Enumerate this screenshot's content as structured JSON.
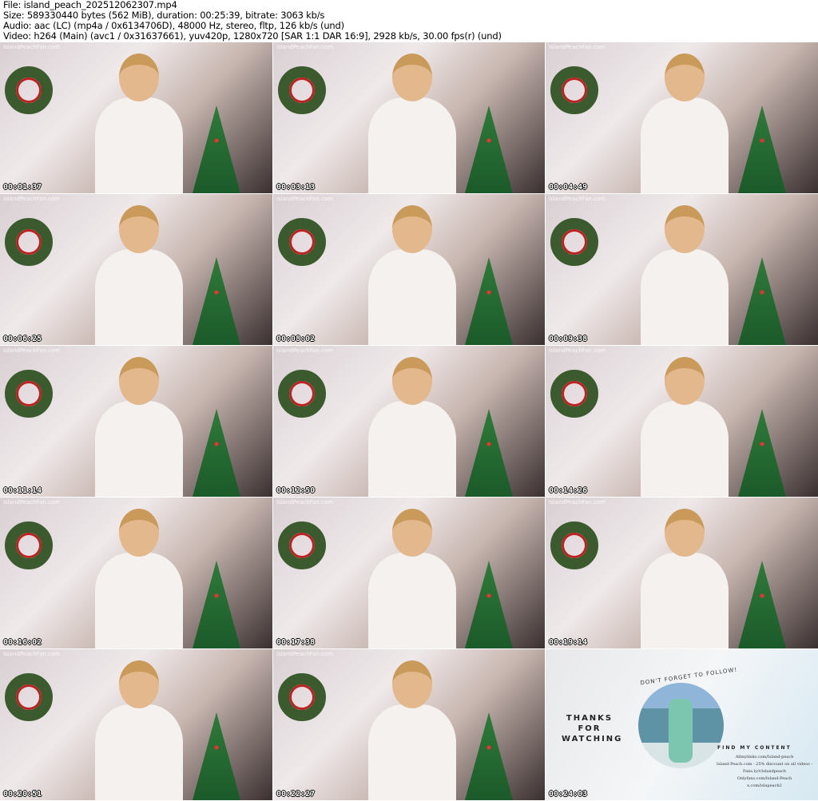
{
  "header": {
    "file": "File: island_peach_202512062307.mp4",
    "size": "Size: 589330440 bytes (562 MiB), duration: 00:25:39, bitrate: 3063 kb/s",
    "audio": "Audio: aac (LC) (mp4a / 0x6134706D), 48000 Hz, stereo, fltp, 126 kb/s (und)",
    "video": "Video: h264 (Main) (avc1 / 0x31637661), yuv420p, 1280x720 [SAR 1:1 DAR 16:9], 2928 kb/s, 30.00 fps(r) (und)"
  },
  "watermark": "IslandPeachFan.com",
  "thumbnails": [
    "00:01:37",
    "00:03:13",
    "00:04:49",
    "00:06:25",
    "00:08:02",
    "00:09:38",
    "00:11:14",
    "00:12:50",
    "00:14:26",
    "00:16:02",
    "00:17:38",
    "00:19:14",
    "00:20:51",
    "00:22:27"
  ],
  "end_card": {
    "timestamp": "00:24:03",
    "thanks": "THANKS FOR WATCHING",
    "follow": "DON'T FORGET TO FOLLOW!",
    "find": "FIND MY CONTENT",
    "links": [
      "Allmylinks.com/Island-peach",
      "Island-Peach.com - 25% discount on all videos -",
      "Fans.ly/r/islandpeach",
      "Onlyfans.com/Island-Peach",
      "x.com/islapeach2"
    ]
  }
}
